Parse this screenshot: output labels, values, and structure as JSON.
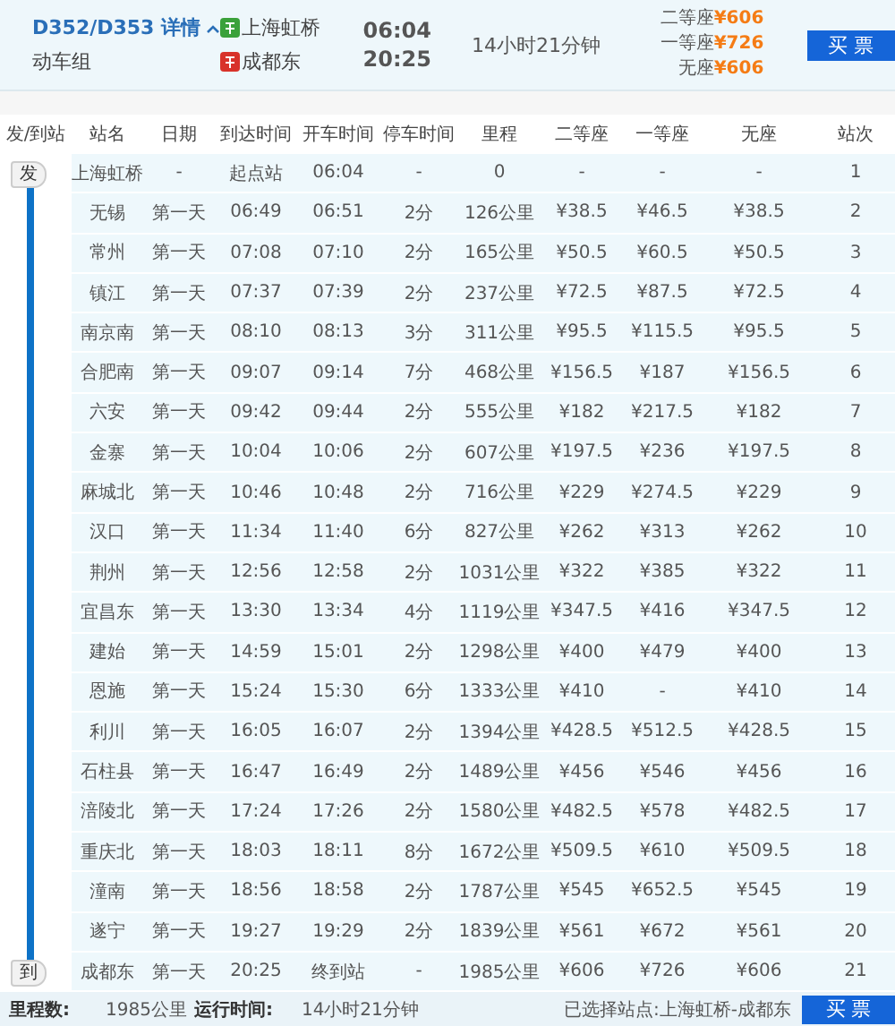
{
  "train": {
    "number": "D352/D353",
    "details": "详情",
    "type": "动车组",
    "expanded": true
  },
  "stations": [
    {
      "kind": "origin",
      "name": "上海虹桥",
      "time": "06:04"
    },
    {
      "kind": "terminal",
      "name": "成都东",
      "time": "20:25"
    }
  ],
  "duration": "14小时21分钟",
  "prices": [
    {
      "label": "二等座",
      "price": "¥606"
    },
    {
      "label": "一等座",
      "price": "¥726"
    },
    {
      "label": "无座",
      "price": "¥606"
    }
  ],
  "buy_button": "买 票",
  "table": {
    "columns": [
      "发/到站",
      "站名",
      "日期",
      "到达时间",
      "开车时间",
      "停车时间",
      "里程",
      "二等座",
      "一等座",
      "无座",
      "站次"
    ],
    "rows": [
      [
        "发",
        "上海虹桥",
        "-",
        "起点站",
        "06:04",
        "-",
        "0",
        "-",
        "-",
        "-",
        "1"
      ],
      [
        "",
        "无锡",
        "第一天",
        "06:49",
        "06:51",
        "2分",
        "126公里",
        "¥38.5",
        "¥46.5",
        "¥38.5",
        "2"
      ],
      [
        "",
        "常州",
        "第一天",
        "07:08",
        "07:10",
        "2分",
        "165公里",
        "¥50.5",
        "¥60.5",
        "¥50.5",
        "3"
      ],
      [
        "",
        "镇江",
        "第一天",
        "07:37",
        "07:39",
        "2分",
        "237公里",
        "¥72.5",
        "¥87.5",
        "¥72.5",
        "4"
      ],
      [
        "",
        "南京南",
        "第一天",
        "08:10",
        "08:13",
        "3分",
        "311公里",
        "¥95.5",
        "¥115.5",
        "¥95.5",
        "5"
      ],
      [
        "",
        "合肥南",
        "第一天",
        "09:07",
        "09:14",
        "7分",
        "468公里",
        "¥156.5",
        "¥187",
        "¥156.5",
        "6"
      ],
      [
        "",
        "六安",
        "第一天",
        "09:42",
        "09:44",
        "2分",
        "555公里",
        "¥182",
        "¥217.5",
        "¥182",
        "7"
      ],
      [
        "",
        "金寨",
        "第一天",
        "10:04",
        "10:06",
        "2分",
        "607公里",
        "¥197.5",
        "¥236",
        "¥197.5",
        "8"
      ],
      [
        "",
        "麻城北",
        "第一天",
        "10:46",
        "10:48",
        "2分",
        "716公里",
        "¥229",
        "¥274.5",
        "¥229",
        "9"
      ],
      [
        "",
        "汉口",
        "第一天",
        "11:34",
        "11:40",
        "6分",
        "827公里",
        "¥262",
        "¥313",
        "¥262",
        "10"
      ],
      [
        "",
        "荆州",
        "第一天",
        "12:56",
        "12:58",
        "2分",
        "1031公里",
        "¥322",
        "¥385",
        "¥322",
        "11"
      ],
      [
        "",
        "宜昌东",
        "第一天",
        "13:30",
        "13:34",
        "4分",
        "1119公里",
        "¥347.5",
        "¥416",
        "¥347.5",
        "12"
      ],
      [
        "",
        "建始",
        "第一天",
        "14:59",
        "15:01",
        "2分",
        "1298公里",
        "¥400",
        "¥479",
        "¥400",
        "13"
      ],
      [
        "",
        "恩施",
        "第一天",
        "15:24",
        "15:30",
        "6分",
        "1333公里",
        "¥410",
        "-",
        "¥410",
        "14"
      ],
      [
        "",
        "利川",
        "第一天",
        "16:05",
        "16:07",
        "2分",
        "1394公里",
        "¥428.5",
        "¥512.5",
        "¥428.5",
        "15"
      ],
      [
        "",
        "石柱县",
        "第一天",
        "16:47",
        "16:49",
        "2分",
        "1489公里",
        "¥456",
        "¥546",
        "¥456",
        "16"
      ],
      [
        "",
        "涪陵北",
        "第一天",
        "17:24",
        "17:26",
        "2分",
        "1580公里",
        "¥482.5",
        "¥578",
        "¥482.5",
        "17"
      ],
      [
        "",
        "重庆北",
        "第一天",
        "18:03",
        "18:11",
        "8分",
        "1672公里",
        "¥509.5",
        "¥610",
        "¥509.5",
        "18"
      ],
      [
        "",
        "潼南",
        "第一天",
        "18:56",
        "18:58",
        "2分",
        "1787公里",
        "¥545",
        "¥652.5",
        "¥545",
        "19"
      ],
      [
        "",
        "遂宁",
        "第一天",
        "19:27",
        "19:29",
        "2分",
        "1839公里",
        "¥561",
        "¥672",
        "¥561",
        "20"
      ],
      [
        "到",
        "成都东",
        "第一天",
        "20:25",
        "终到站",
        "-",
        "1985公里",
        "¥606",
        "¥726",
        "¥606",
        "21"
      ]
    ]
  },
  "footer": {
    "distance_label": "里程数:",
    "distance": "1985公里",
    "time_label": "运行时间:",
    "time": "14小时21分钟",
    "selected_label": "已选择站点:",
    "selected": "上海虹桥-成都东",
    "buy_button": "买 票"
  }
}
